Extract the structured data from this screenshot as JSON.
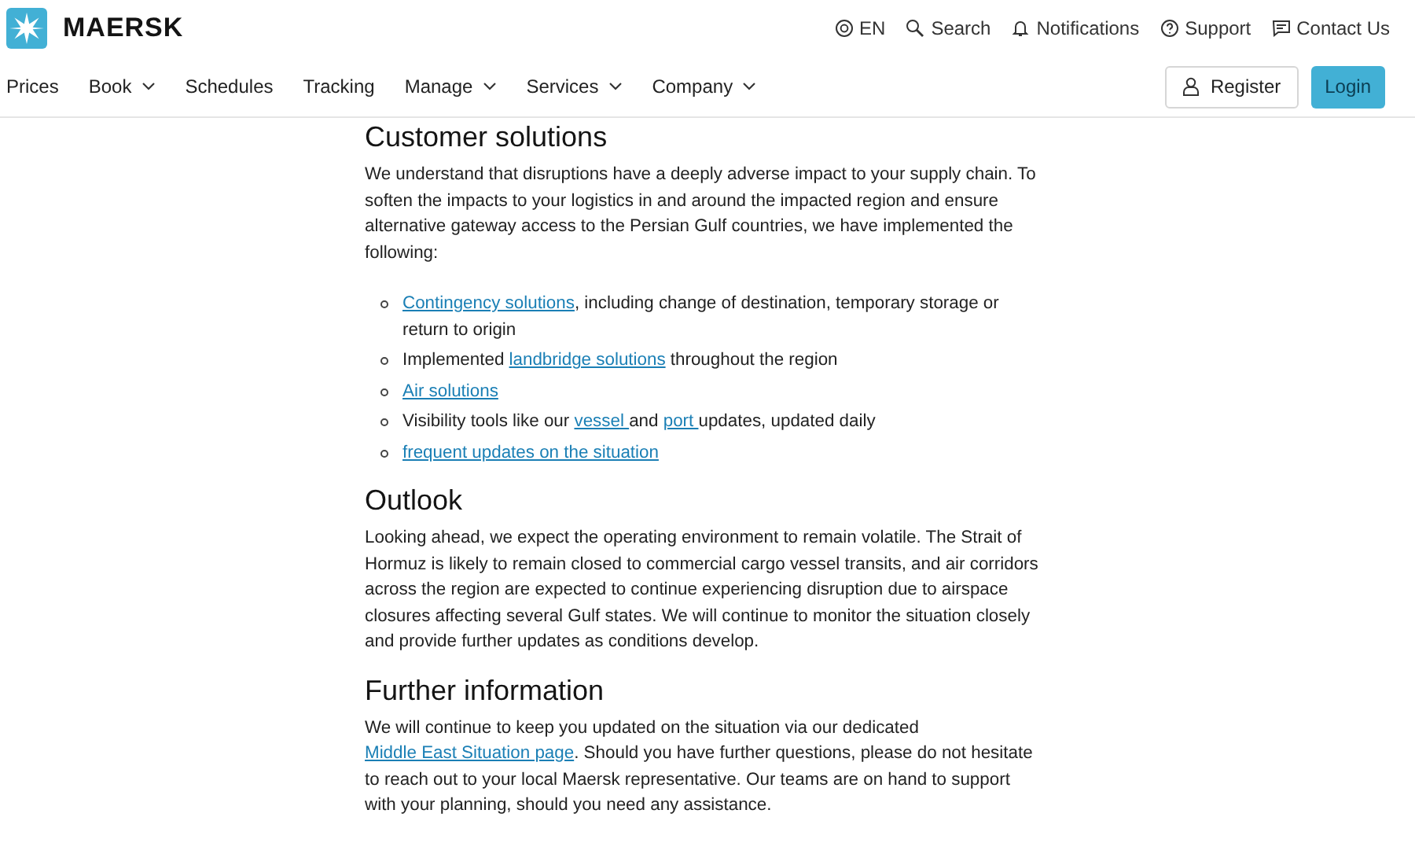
{
  "header": {
    "logo": "MAERSK",
    "utility_links": [
      {
        "label": "EN",
        "kind": "language"
      },
      {
        "label": "Search",
        "kind": "search"
      },
      {
        "label": "Notifications",
        "kind": "notifications"
      },
      {
        "label": "Support",
        "kind": "support"
      },
      {
        "label": "Contact Us",
        "kind": "contact"
      }
    ],
    "nav": [
      {
        "label": "Prices",
        "dropdown": false
      },
      {
        "label": "Book",
        "dropdown": true
      },
      {
        "label": "Schedules",
        "dropdown": false
      },
      {
        "label": "Tracking",
        "dropdown": false
      },
      {
        "label": "Manage",
        "dropdown": true
      },
      {
        "label": "Services",
        "dropdown": true
      },
      {
        "label": "Company",
        "dropdown": true
      }
    ],
    "register": "Register",
    "login": "Login"
  },
  "sections": [
    {
      "heading": "Customer solutions",
      "paragraphs": [
        [
          {
            "kind": "text",
            "text": "We understand that disruptions have a deeply adverse impact to your supply chain. To soften the impacts to your logistics in and around the impacted region and ensure alternative gateway access to the Persian Gulf countries, we have implemented the following:"
          }
        ]
      ],
      "bullets": [
        [
          {
            "kind": "link",
            "text": "Contingency solutions"
          },
          {
            "kind": "text",
            "text": ", including change of destination, temporary storage or return to origin"
          }
        ],
        [
          {
            "kind": "text",
            "text": "Implemented "
          },
          {
            "kind": "link",
            "text": "landbridge solutions"
          },
          {
            "kind": "text",
            "text": " throughout the region"
          }
        ],
        [
          {
            "kind": "link",
            "text": "Air solutions"
          }
        ],
        [
          {
            "kind": "text",
            "text": "Visibility tools like our "
          },
          {
            "kind": "link",
            "text": "vessel "
          },
          {
            "kind": "text",
            "text": "and "
          },
          {
            "kind": "link",
            "text": "port "
          },
          {
            "kind": "text",
            "text": "updates, updated daily"
          }
        ],
        [
          {
            "kind": "link",
            "text": "frequent updates on the situation"
          }
        ]
      ]
    },
    {
      "heading": "Outlook",
      "paragraphs": [
        [
          {
            "kind": "text",
            "text": "Looking ahead, we expect the operating environment to remain volatile. The Strait of Hormuz is likely to remain closed to commercial cargo vessel transits, and air corridors across the region are expected to continue experiencing disruption due to airspace closures affecting several Gulf states. We will continue to monitor the situation closely and provide further updates as conditions develop."
          }
        ]
      ]
    },
    {
      "heading": "Further information",
      "paragraphs": [
        [
          {
            "kind": "text",
            "text": "We will continue to keep you updated on the situation via our dedicated "
          },
          {
            "kind": "link",
            "text": "Middle East Situation page"
          },
          {
            "kind": "text",
            "text": ". Should you have further questions, please do not hesitate to reach out to your local Maersk representative. Our teams are on hand to support with your planning, should you need any assistance."
          }
        ]
      ]
    }
  ]
}
